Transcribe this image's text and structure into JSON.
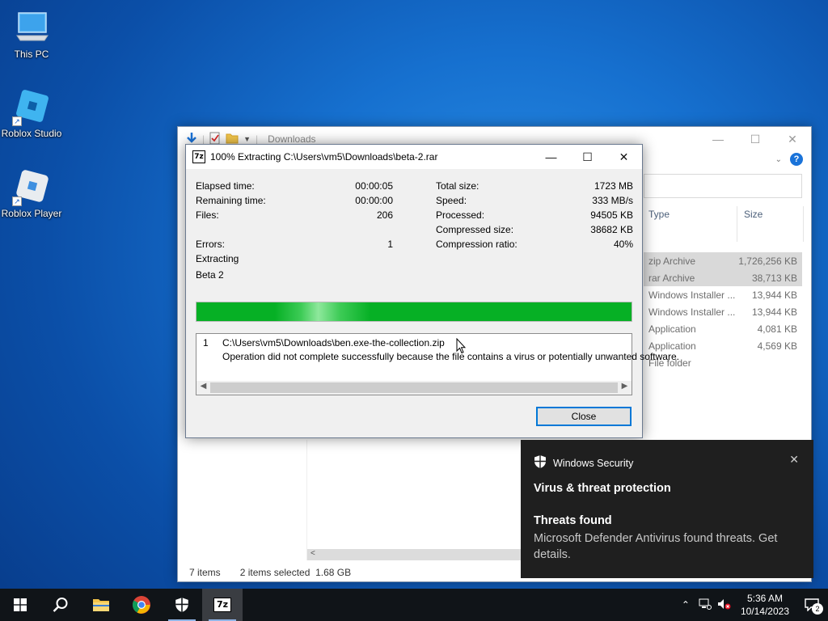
{
  "desktop": {
    "icons": [
      {
        "label": "This PC"
      },
      {
        "label": "Roblox Studio"
      },
      {
        "label": "Roblox Player"
      }
    ]
  },
  "explorer": {
    "title": "Downloads",
    "columns": {
      "type": "Type",
      "size": "Size"
    },
    "rows": [
      {
        "type": "zip Archive",
        "size": "1,726,256 KB",
        "selected": true
      },
      {
        "type": "rar Archive",
        "size": "38,713 KB",
        "selected": true
      },
      {
        "type": "Windows Installer ...",
        "size": "13,944 KB"
      },
      {
        "type": "Windows Installer ...",
        "size": "13,944 KB"
      },
      {
        "type": "Application",
        "size": "4,081 KB"
      },
      {
        "type": "Application",
        "size": "4,569 KB"
      },
      {
        "type": "File folder",
        "size": ""
      }
    ],
    "status": {
      "items": "7 items",
      "selected": "2 items selected",
      "sel_size": "1.68 GB"
    }
  },
  "dialog": {
    "title": "100% Extracting C:\\Users\\vm5\\Downloads\\beta-2.rar",
    "progress": 1.0,
    "stats_left": [
      {
        "label": "Elapsed time:",
        "value": "00:00:05"
      },
      {
        "label": "Remaining time:",
        "value": "00:00:00"
      },
      {
        "label": "Files:",
        "value": "206"
      },
      {
        "label": "",
        "value": ""
      },
      {
        "label": "Errors:",
        "value": "1"
      }
    ],
    "stats_right": [
      {
        "label": "Total size:",
        "value": "1723 MB"
      },
      {
        "label": "Speed:",
        "value": "333 MB/s"
      },
      {
        "label": "Processed:",
        "value": "94505 KB"
      },
      {
        "label": "Compressed size:",
        "value": "38682 KB"
      },
      {
        "label": "Compression ratio:",
        "value": "40%"
      }
    ],
    "status_text": "Extracting",
    "current_item": "Beta 2",
    "message": {
      "num": "1",
      "path": "C:\\Users\\vm5\\Downloads\\ben.exe-the-collection.zip",
      "text": "Operation did not complete successfully because the file contains a virus or potentially unwanted software."
    },
    "close_label": "Close"
  },
  "toast": {
    "app": "Windows Security",
    "heading": "Virus & threat protection",
    "subheading": "Threats found",
    "body": "Microsoft Defender Antivirus found threats. Get details."
  },
  "taskbar": {
    "apps": [
      "start-icon",
      "search-icon",
      "file-explorer-icon",
      "chrome-icon",
      "windows-security-icon",
      "7zip-icon"
    ],
    "time": "5:36 AM",
    "date": "10/14/2023",
    "notification_count": "2"
  },
  "colors": {
    "progress_fill": "#06b025",
    "accent": "#0078d7",
    "toast_bg": "#1f1f1f"
  }
}
